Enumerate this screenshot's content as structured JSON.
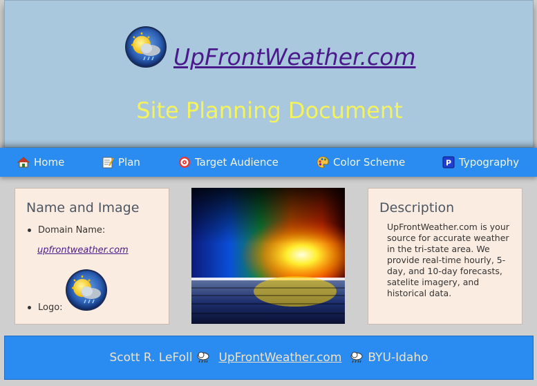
{
  "header": {
    "site_name": "UpFrontWeather.com",
    "doc_title": "Site Planning Document"
  },
  "nav": {
    "items": [
      {
        "label": "Home",
        "icon": "house-icon"
      },
      {
        "label": "Plan",
        "icon": "memo-icon"
      },
      {
        "label": "Target Audience",
        "icon": "target-icon"
      },
      {
        "label": "Color Scheme",
        "icon": "palette-icon"
      },
      {
        "label": "Typography",
        "icon": "p-square-icon"
      }
    ]
  },
  "name_image": {
    "heading": "Name and Image",
    "domain_label": "Domain Name:",
    "domain_value": "upfrontweather.com",
    "logo_label": "Logo:"
  },
  "description": {
    "heading": "Description",
    "text": "UpFrontWeather.com is your source for accurate weather in the tri-state area. We provide real-time hourly, 5-day, and 10-day forecasts, satelite imagery, and historical data."
  },
  "footer": {
    "author": "Scott R. LeFoll",
    "site_link": "UpFrontWeather.com",
    "school": "BYU-Idaho"
  },
  "colors": {
    "header_bg": "#a9c8de",
    "nav_bg": "#2a8bf0",
    "title_yellow": "#f4f25e",
    "link_purple": "#4b1a8a",
    "card_bg": "#fbece1"
  }
}
